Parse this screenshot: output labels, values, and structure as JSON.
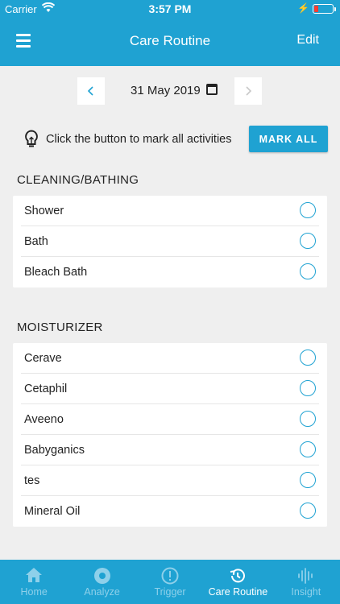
{
  "status": {
    "carrier": "Carrier",
    "time": "3:57 PM"
  },
  "nav": {
    "title": "Care Routine",
    "edit": "Edit"
  },
  "date": {
    "prev_icon": "‹",
    "next_icon": "›",
    "value": "31 May 2019"
  },
  "mark": {
    "hint": "Click the button to mark all activities",
    "button": "MARK ALL"
  },
  "sections": [
    {
      "title": "CLEANING/BATHING",
      "items": [
        "Shower",
        "Bath",
        "Bleach Bath"
      ]
    },
    {
      "title": "MOISTURIZER",
      "items": [
        "Cerave",
        "Cetaphil",
        "Aveeno",
        "Babyganics",
        "tes",
        "Mineral Oil"
      ]
    }
  ],
  "tabs": [
    {
      "label": "Home",
      "icon": "home-icon",
      "active": false
    },
    {
      "label": "Analyze",
      "icon": "analyze-icon",
      "active": false
    },
    {
      "label": "Trigger",
      "icon": "trigger-icon",
      "active": false
    },
    {
      "label": "Care Routine",
      "icon": "history-icon",
      "active": true
    },
    {
      "label": "Insight",
      "icon": "waveform-icon",
      "active": false
    }
  ],
  "colors": {
    "accent": "#1fa2d2",
    "background": "#efefef",
    "battery_low": "#ff3b30"
  }
}
